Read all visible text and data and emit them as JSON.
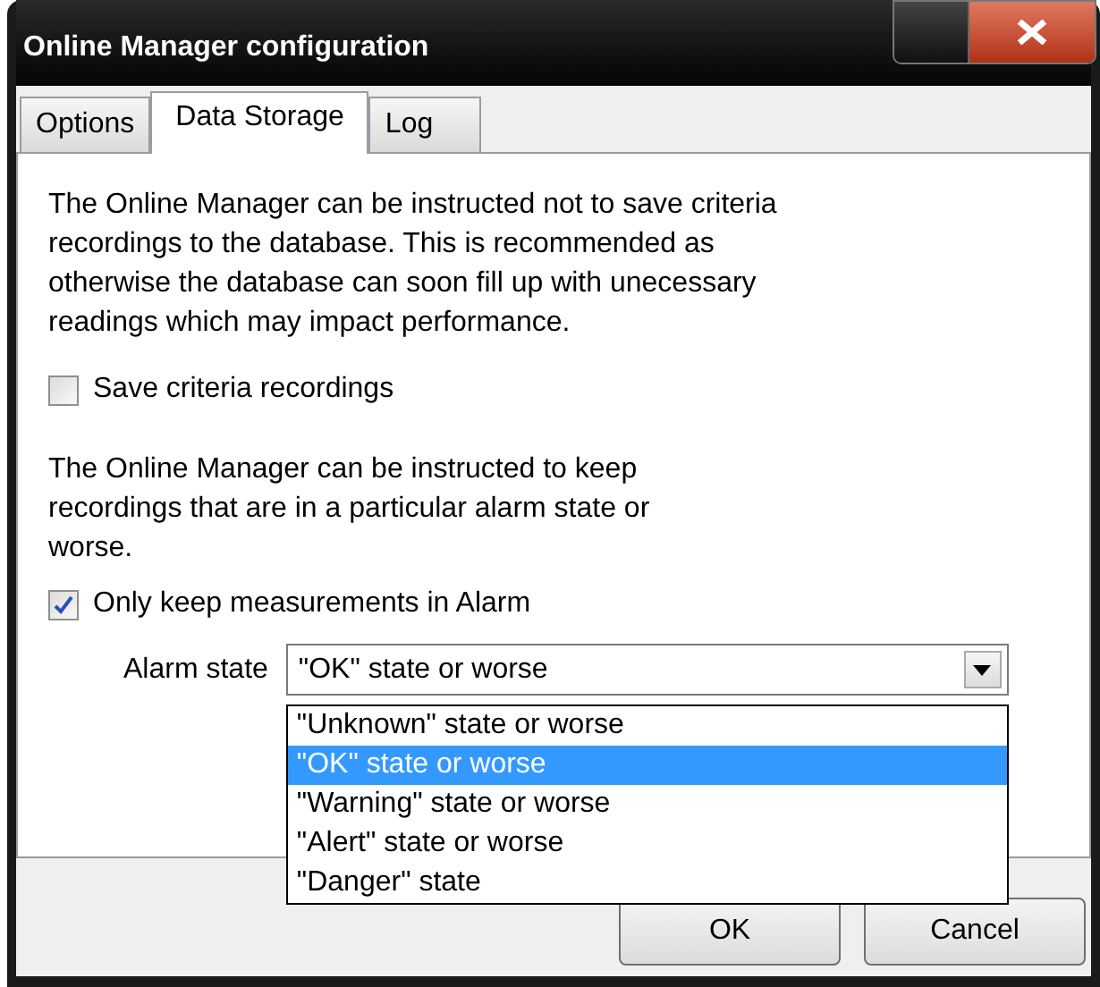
{
  "window": {
    "title": "Online Manager configuration"
  },
  "tabs": [
    {
      "label": "Options",
      "selected": false
    },
    {
      "label": "Data Storage",
      "selected": true
    },
    {
      "label": "Log",
      "selected": false
    }
  ],
  "intro_text": "The Online Manager can be instructed not to save criteria recordings to the database. This is recommended as otherwise the database can soon fill up with unecessary readings which may impact performance.",
  "save_criteria": {
    "label": "Save criteria recordings",
    "checked": false
  },
  "keep_text": "The Online Manager can be instructed to keep recordings that are in a particular alarm state or worse.",
  "only_alarm": {
    "label": "Only keep measurements in Alarm",
    "checked": true
  },
  "alarm_state": {
    "label": "Alarm state",
    "value": "\"OK\" state or worse",
    "expanded": true,
    "options": [
      {
        "label": "\"Unknown\" state or worse",
        "selected": false
      },
      {
        "label": "\"OK\" state or worse",
        "selected": true
      },
      {
        "label": "\"Warning\" state or worse",
        "selected": false
      },
      {
        "label": "\"Alert\" state or worse",
        "selected": false
      },
      {
        "label": "\"Danger\" state",
        "selected": false
      }
    ]
  },
  "buttons": [
    "OK",
    "Cancel"
  ]
}
